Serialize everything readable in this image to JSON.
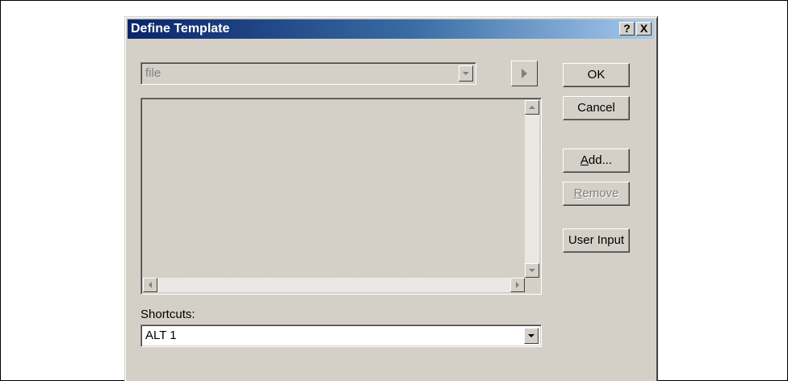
{
  "dialog": {
    "title": "Define Template",
    "help_glyph": "?",
    "close_glyph": "X"
  },
  "template_combo": {
    "value": "file",
    "disabled": true,
    "icon": "chevron-down-icon"
  },
  "insert_button": {
    "icon": "play-icon"
  },
  "buttons": {
    "ok": "OK",
    "cancel": "Cancel",
    "add_prefix": "A",
    "add_rest": "dd...",
    "remove_prefix": "R",
    "remove_rest": "emove",
    "user_input": "User Input"
  },
  "shortcuts": {
    "label": "Shortcuts:",
    "value": "ALT 1"
  },
  "colors": {
    "title_start": "#0a246a",
    "title_end": "#a6caf0",
    "face": "#d4d0c8"
  }
}
